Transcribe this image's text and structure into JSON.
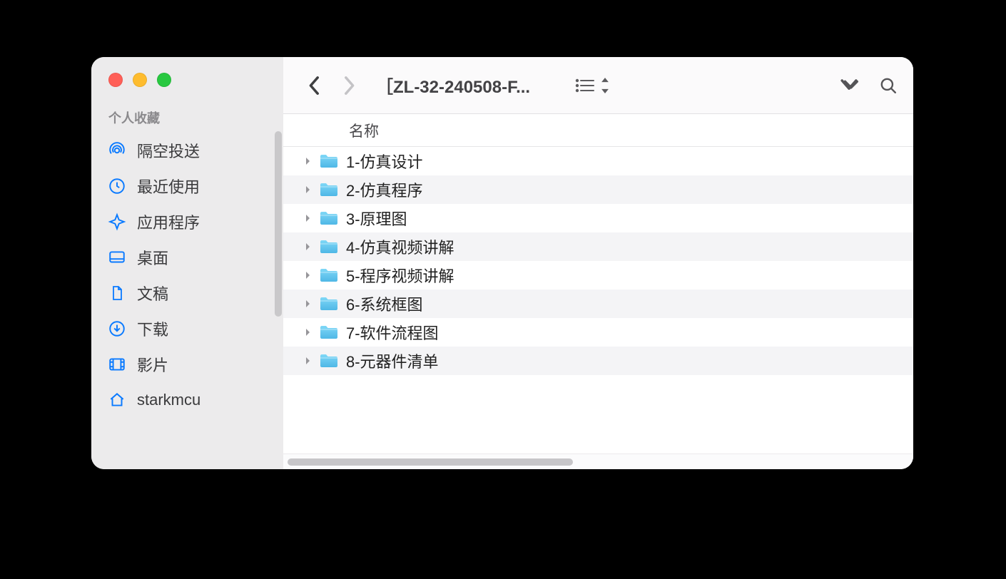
{
  "window": {
    "title": "［ZL-32-240508-F..."
  },
  "sidebar": {
    "section_header": "个人收藏",
    "items": [
      {
        "icon": "airdrop",
        "label": "隔空投送"
      },
      {
        "icon": "clock",
        "label": "最近使用"
      },
      {
        "icon": "apps",
        "label": "应用程序"
      },
      {
        "icon": "desktop",
        "label": "桌面"
      },
      {
        "icon": "doc",
        "label": "文稿"
      },
      {
        "icon": "download",
        "label": "下载"
      },
      {
        "icon": "movie",
        "label": "影片"
      },
      {
        "icon": "home",
        "label": "starkmcu"
      }
    ]
  },
  "columns": {
    "name": "名称"
  },
  "files": [
    "1-仿真设计",
    "2-仿真程序",
    "3-原理图",
    "4-仿真视频讲解",
    "5-程序视频讲解",
    "6-系统框图",
    "7-软件流程图",
    "8-元器件清单"
  ]
}
